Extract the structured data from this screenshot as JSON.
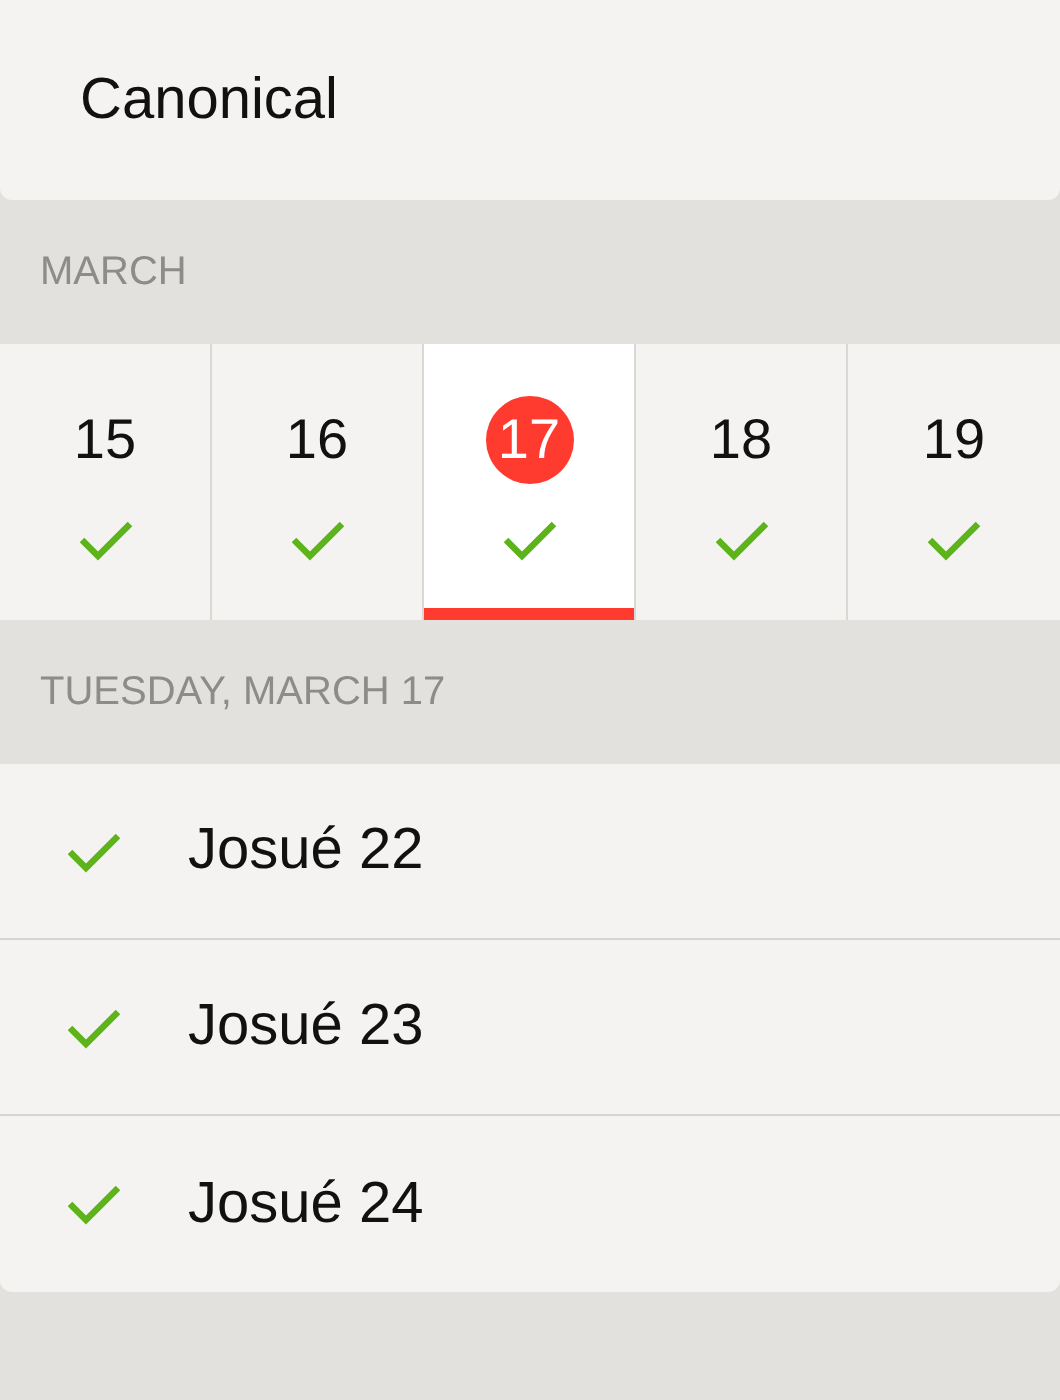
{
  "title": "Canonical",
  "month_header": "MARCH",
  "days": [
    {
      "day": "15",
      "done": true,
      "selected": false
    },
    {
      "day": "16",
      "done": true,
      "selected": false
    },
    {
      "day": "17",
      "done": true,
      "selected": true
    },
    {
      "day": "18",
      "done": true,
      "selected": false
    },
    {
      "day": "19",
      "done": true,
      "selected": false
    }
  ],
  "date_header": "TUESDAY, MARCH 17",
  "readings": [
    {
      "label": "Josué 22",
      "done": true
    },
    {
      "label": "Josué 23",
      "done": true
    },
    {
      "label": "Josué 24",
      "done": true
    }
  ]
}
